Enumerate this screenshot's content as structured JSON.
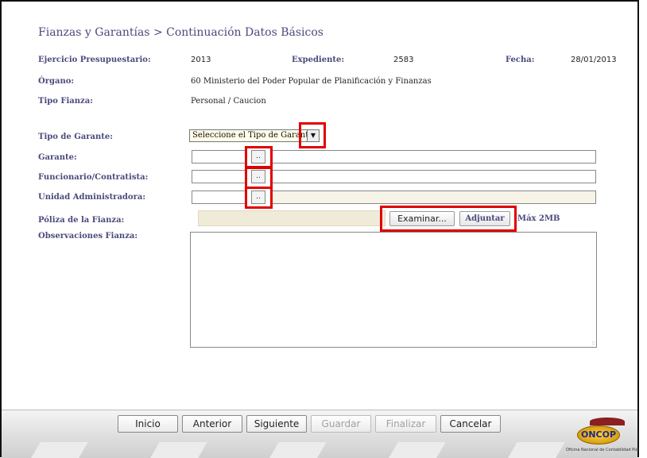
{
  "title": "Fianzas y Garantías > Continuación Datos Básicos",
  "header": {
    "ejercicio_label": "Ejercicio Presupuestario:",
    "ejercicio_value": "2013",
    "expediente_label": "Expediente:",
    "expediente_value": "2583",
    "fecha_label": "Fecha:",
    "fecha_value": "28/01/2013",
    "organo_label": "Órgano:",
    "organo_value": "60 Ministerio del Poder Popular de Planificación y Finanzas",
    "tipo_fianza_label": "Tipo Fianza:",
    "tipo_fianza_value": "Personal / Caucion"
  },
  "form": {
    "tipo_garante_label": "Tipo de Garante:",
    "tipo_garante_selected": "Seleccione el Tipo de Garante",
    "garante_label": "Garante:",
    "funcionario_label": "Funcionario/Contratista:",
    "unidad_label": "Unidad Administradora:",
    "lookup_button_label": "..",
    "poliza_label": "Póliza de la Fianza:",
    "examinar_label": "Examinar...",
    "adjuntar_label": "Adjuntar",
    "max_size": "Máx 2MB",
    "observaciones_label": "Observaciones Fianza:",
    "resize_grip": "::"
  },
  "nav": {
    "inicio": "Inicio",
    "anterior": "Anterior",
    "siguiente": "Siguiente",
    "guardar": "Guardar",
    "finalizar": "Finalizar",
    "cancelar": "Cancelar"
  },
  "logo": {
    "name": "ONCOP",
    "caption": "Oficina Nacional de Contabilidad Pública"
  },
  "colors": {
    "label": "#4a4a7c",
    "highlight": "#e00000",
    "readonly_field": "#f7f3e6"
  }
}
